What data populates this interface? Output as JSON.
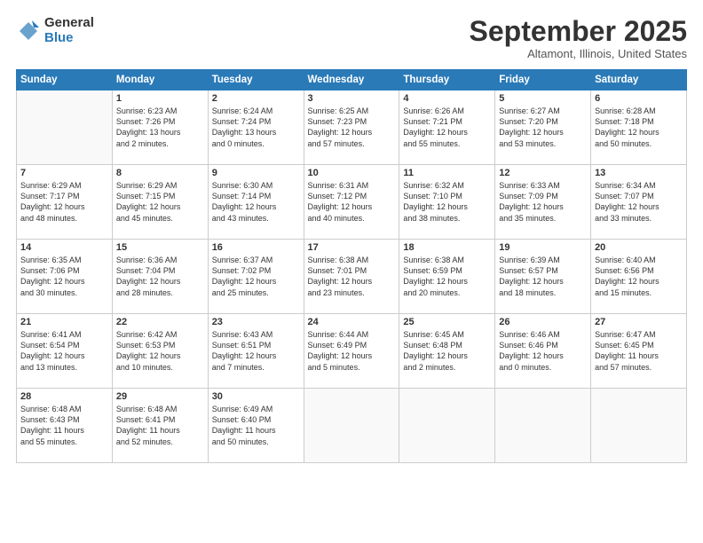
{
  "header": {
    "logo_general": "General",
    "logo_blue": "Blue",
    "month_title": "September 2025",
    "location": "Altamont, Illinois, United States"
  },
  "days_of_week": [
    "Sunday",
    "Monday",
    "Tuesday",
    "Wednesday",
    "Thursday",
    "Friday",
    "Saturday"
  ],
  "weeks": [
    [
      {
        "day": "",
        "content": ""
      },
      {
        "day": "1",
        "content": "Sunrise: 6:23 AM\nSunset: 7:26 PM\nDaylight: 13 hours\nand 2 minutes."
      },
      {
        "day": "2",
        "content": "Sunrise: 6:24 AM\nSunset: 7:24 PM\nDaylight: 13 hours\nand 0 minutes."
      },
      {
        "day": "3",
        "content": "Sunrise: 6:25 AM\nSunset: 7:23 PM\nDaylight: 12 hours\nand 57 minutes."
      },
      {
        "day": "4",
        "content": "Sunrise: 6:26 AM\nSunset: 7:21 PM\nDaylight: 12 hours\nand 55 minutes."
      },
      {
        "day": "5",
        "content": "Sunrise: 6:27 AM\nSunset: 7:20 PM\nDaylight: 12 hours\nand 53 minutes."
      },
      {
        "day": "6",
        "content": "Sunrise: 6:28 AM\nSunset: 7:18 PM\nDaylight: 12 hours\nand 50 minutes."
      }
    ],
    [
      {
        "day": "7",
        "content": "Sunrise: 6:29 AM\nSunset: 7:17 PM\nDaylight: 12 hours\nand 48 minutes."
      },
      {
        "day": "8",
        "content": "Sunrise: 6:29 AM\nSunset: 7:15 PM\nDaylight: 12 hours\nand 45 minutes."
      },
      {
        "day": "9",
        "content": "Sunrise: 6:30 AM\nSunset: 7:14 PM\nDaylight: 12 hours\nand 43 minutes."
      },
      {
        "day": "10",
        "content": "Sunrise: 6:31 AM\nSunset: 7:12 PM\nDaylight: 12 hours\nand 40 minutes."
      },
      {
        "day": "11",
        "content": "Sunrise: 6:32 AM\nSunset: 7:10 PM\nDaylight: 12 hours\nand 38 minutes."
      },
      {
        "day": "12",
        "content": "Sunrise: 6:33 AM\nSunset: 7:09 PM\nDaylight: 12 hours\nand 35 minutes."
      },
      {
        "day": "13",
        "content": "Sunrise: 6:34 AM\nSunset: 7:07 PM\nDaylight: 12 hours\nand 33 minutes."
      }
    ],
    [
      {
        "day": "14",
        "content": "Sunrise: 6:35 AM\nSunset: 7:06 PM\nDaylight: 12 hours\nand 30 minutes."
      },
      {
        "day": "15",
        "content": "Sunrise: 6:36 AM\nSunset: 7:04 PM\nDaylight: 12 hours\nand 28 minutes."
      },
      {
        "day": "16",
        "content": "Sunrise: 6:37 AM\nSunset: 7:02 PM\nDaylight: 12 hours\nand 25 minutes."
      },
      {
        "day": "17",
        "content": "Sunrise: 6:38 AM\nSunset: 7:01 PM\nDaylight: 12 hours\nand 23 minutes."
      },
      {
        "day": "18",
        "content": "Sunrise: 6:38 AM\nSunset: 6:59 PM\nDaylight: 12 hours\nand 20 minutes."
      },
      {
        "day": "19",
        "content": "Sunrise: 6:39 AM\nSunset: 6:57 PM\nDaylight: 12 hours\nand 18 minutes."
      },
      {
        "day": "20",
        "content": "Sunrise: 6:40 AM\nSunset: 6:56 PM\nDaylight: 12 hours\nand 15 minutes."
      }
    ],
    [
      {
        "day": "21",
        "content": "Sunrise: 6:41 AM\nSunset: 6:54 PM\nDaylight: 12 hours\nand 13 minutes."
      },
      {
        "day": "22",
        "content": "Sunrise: 6:42 AM\nSunset: 6:53 PM\nDaylight: 12 hours\nand 10 minutes."
      },
      {
        "day": "23",
        "content": "Sunrise: 6:43 AM\nSunset: 6:51 PM\nDaylight: 12 hours\nand 7 minutes."
      },
      {
        "day": "24",
        "content": "Sunrise: 6:44 AM\nSunset: 6:49 PM\nDaylight: 12 hours\nand 5 minutes."
      },
      {
        "day": "25",
        "content": "Sunrise: 6:45 AM\nSunset: 6:48 PM\nDaylight: 12 hours\nand 2 minutes."
      },
      {
        "day": "26",
        "content": "Sunrise: 6:46 AM\nSunset: 6:46 PM\nDaylight: 12 hours\nand 0 minutes."
      },
      {
        "day": "27",
        "content": "Sunrise: 6:47 AM\nSunset: 6:45 PM\nDaylight: 11 hours\nand 57 minutes."
      }
    ],
    [
      {
        "day": "28",
        "content": "Sunrise: 6:48 AM\nSunset: 6:43 PM\nDaylight: 11 hours\nand 55 minutes."
      },
      {
        "day": "29",
        "content": "Sunrise: 6:48 AM\nSunset: 6:41 PM\nDaylight: 11 hours\nand 52 minutes."
      },
      {
        "day": "30",
        "content": "Sunrise: 6:49 AM\nSunset: 6:40 PM\nDaylight: 11 hours\nand 50 minutes."
      },
      {
        "day": "",
        "content": ""
      },
      {
        "day": "",
        "content": ""
      },
      {
        "day": "",
        "content": ""
      },
      {
        "day": "",
        "content": ""
      }
    ]
  ]
}
